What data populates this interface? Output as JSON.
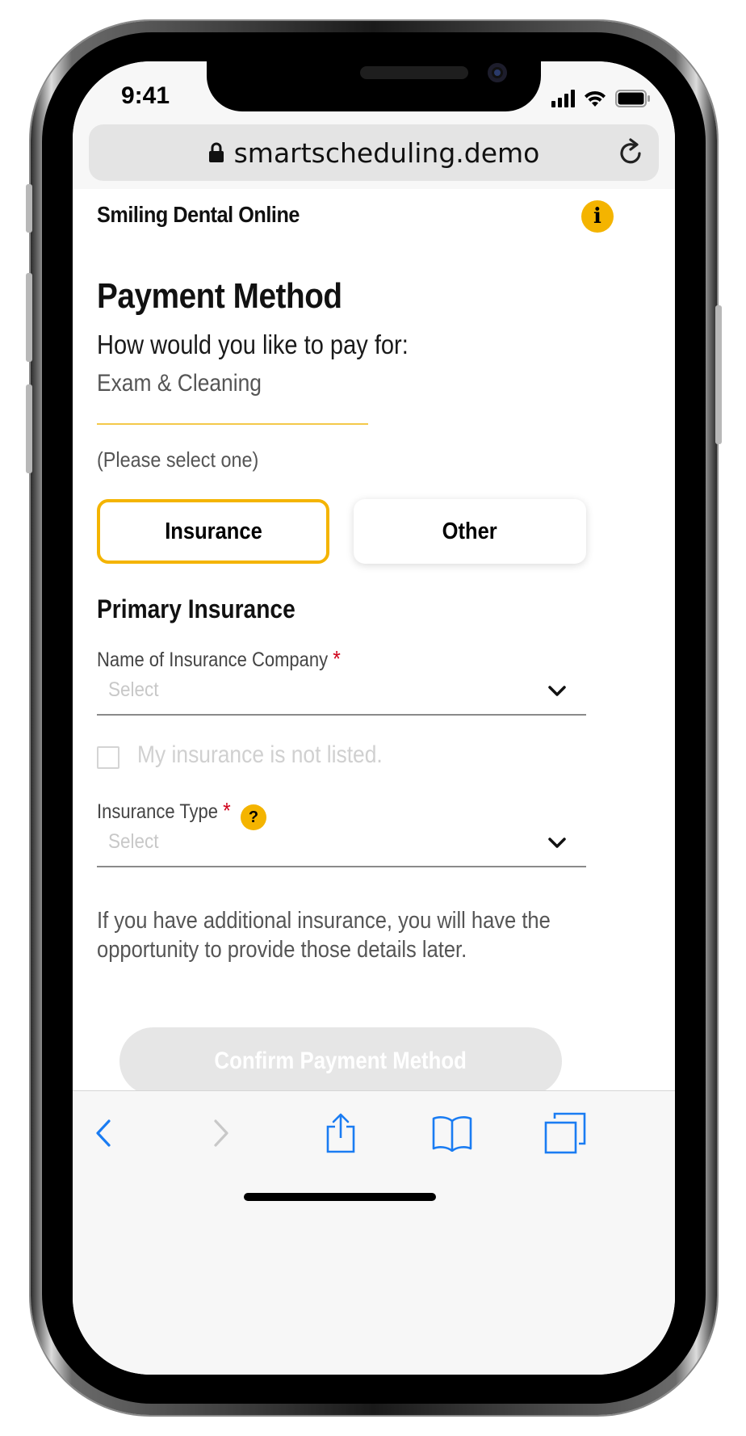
{
  "status_bar": {
    "time": "9:41"
  },
  "browser": {
    "url": "smartscheduling.demo"
  },
  "header": {
    "brand": "Smiling Dental Online",
    "info_badge": "i"
  },
  "page": {
    "title": "Payment Method",
    "question": "How would you like to pay for:",
    "service": "Exam & Cleaning",
    "select_hint": "(Please select one)"
  },
  "options": {
    "insurance": "Insurance",
    "other": "Other",
    "selected": "Insurance"
  },
  "primary_insurance": {
    "title": "Primary Insurance",
    "company_label": "Name of Insurance Company",
    "company_placeholder": "Select",
    "not_listed_label": "My insurance is not listed.",
    "type_label": "Insurance Type",
    "type_placeholder": "Select",
    "help_badge": "?",
    "required_mark": "*"
  },
  "note": "If you have additional insurance, you will have the opportunity to provide those details later.",
  "confirm_button": "Confirm Payment Method",
  "colors": {
    "accent": "#f4b400",
    "required": "#d0021b",
    "safari_blue": "#1a7cf2",
    "disabled_button": "#e6e6e6"
  },
  "toolbar": {
    "icons": [
      "back-icon",
      "forward-icon",
      "share-icon",
      "bookmarks-icon",
      "tabs-icon"
    ]
  }
}
